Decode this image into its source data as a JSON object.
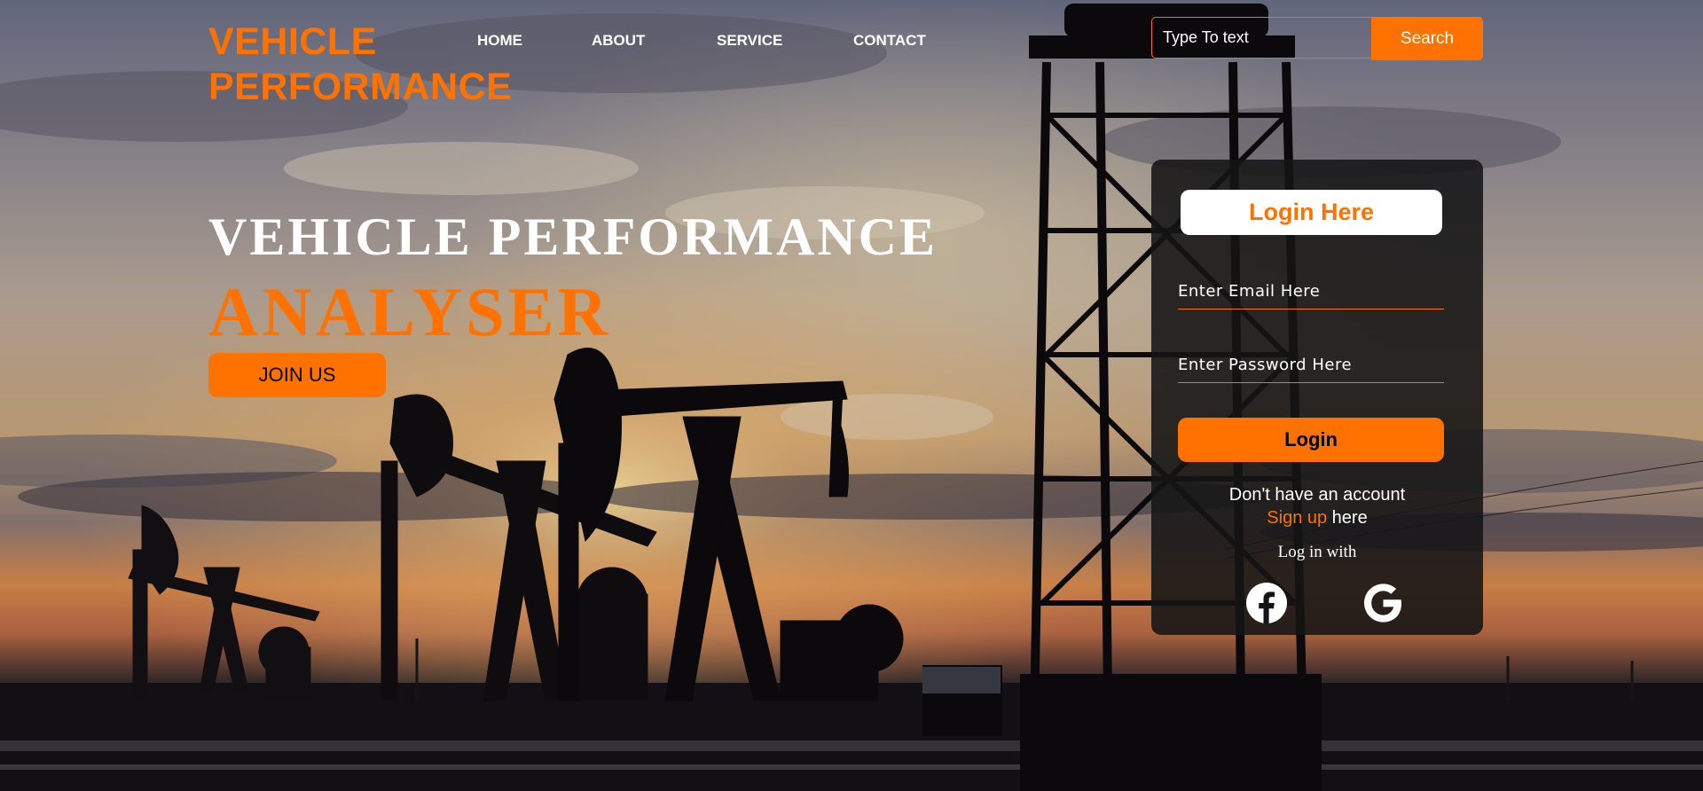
{
  "brand": {
    "line1": "VEHICLE",
    "line2": "PERFORMANCE"
  },
  "nav": {
    "items": [
      {
        "label": "HOME"
      },
      {
        "label": "ABOUT"
      },
      {
        "label": "SERVICE"
      },
      {
        "label": "CONTACT"
      }
    ]
  },
  "search": {
    "placeholder": "Type To text",
    "button_label": "Search"
  },
  "hero": {
    "line1": "VEHICLE PERFORMANCE",
    "line2": "ANALYSER",
    "join_label": "JOIN US"
  },
  "login": {
    "title": "Login Here",
    "email_placeholder": "Enter Email Here",
    "password_placeholder": "Enter Password Here",
    "button_label": "Login",
    "no_account_text": "Don't have an account",
    "signup_link": "Sign up",
    "signup_suffix": " here",
    "login_with": "Log in with",
    "social": [
      {
        "icon": "facebook-icon"
      },
      {
        "icon": "google-icon"
      }
    ]
  },
  "colors": {
    "accent": "#ff7200",
    "panel": "#141416",
    "text": "#ffffff"
  }
}
